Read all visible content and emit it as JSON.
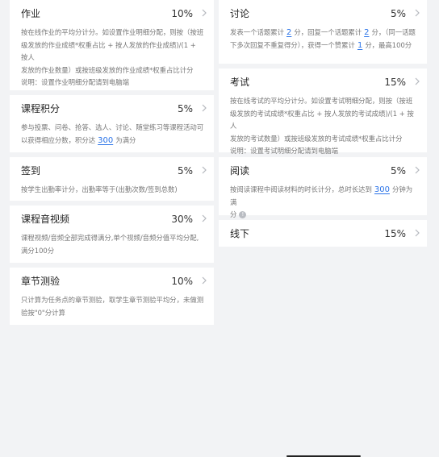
{
  "left": {
    "homework": {
      "title": "作业",
      "percent": "10%",
      "lines": [
        "按在线作业的平均分计分。如设置作业明细分配，则按（按班",
        "级发放的作业成绩*权重占比 + 按人发放的作业成绩)/(1 + 按人",
        "发放的作业数量）或按班级发放的作业成绩*权重占比计分",
        "说明：设置作业明细分配请到电脑端"
      ]
    },
    "course_points": {
      "title": "课程积分",
      "percent": "5%",
      "line1": "参与投票、问卷、抢答、选人、讨论、随堂练习等课程活动可",
      "pre": "以获得相应分数，积分达",
      "value": "300",
      "post": "为满分"
    },
    "checkin": {
      "title": "签到",
      "percent": "5%",
      "desc": "按学生出勤率计分，出勤率等于(出勤次数/签到总数)"
    },
    "video": {
      "title": "课程音视频",
      "percent": "30%",
      "lines": [
        "课程视频/音频全部完成得满分,单个视频/音频分值平均分配,",
        "满分100分"
      ]
    },
    "quiz": {
      "title": "章节测验",
      "percent": "10%",
      "lines": [
        "只计算为任务点的章节测验，取学生章节测验平均分，未做测",
        "验按\"0\"分计算"
      ]
    }
  },
  "right": {
    "discussion": {
      "title": "讨论",
      "percent": "5%",
      "s1": "发表一个话题累计",
      "v1": "2",
      "s2": "分，回复一个话题累计",
      "v2": "2",
      "s3": "分，（同一话题",
      "s4": "下多次回复不重复得分），获得一个赞累计",
      "v3": "1",
      "s5": "分，最高100分"
    },
    "exam": {
      "title": "考试",
      "percent": "15%",
      "lines": [
        "按在线考试的平均分计分。如设置考试明细分配，则按（按班",
        "级发放的考试成绩*权重占比 + 按人发放的考试成绩)/(1 + 按人",
        "发放的考试数量）或按班级发放的考试成绩*权重占比计分",
        "说明：设置考试明细分配请到电脑端"
      ]
    },
    "reading": {
      "title": "阅读",
      "percent": "5%",
      "pre": "按阅读课程中阅读材料的时长计分，总时长达到",
      "value": "300",
      "post": "分钟为满",
      "line2": "分",
      "info_icon": "!"
    },
    "offline": {
      "title": "线下",
      "percent": "15%"
    }
  }
}
